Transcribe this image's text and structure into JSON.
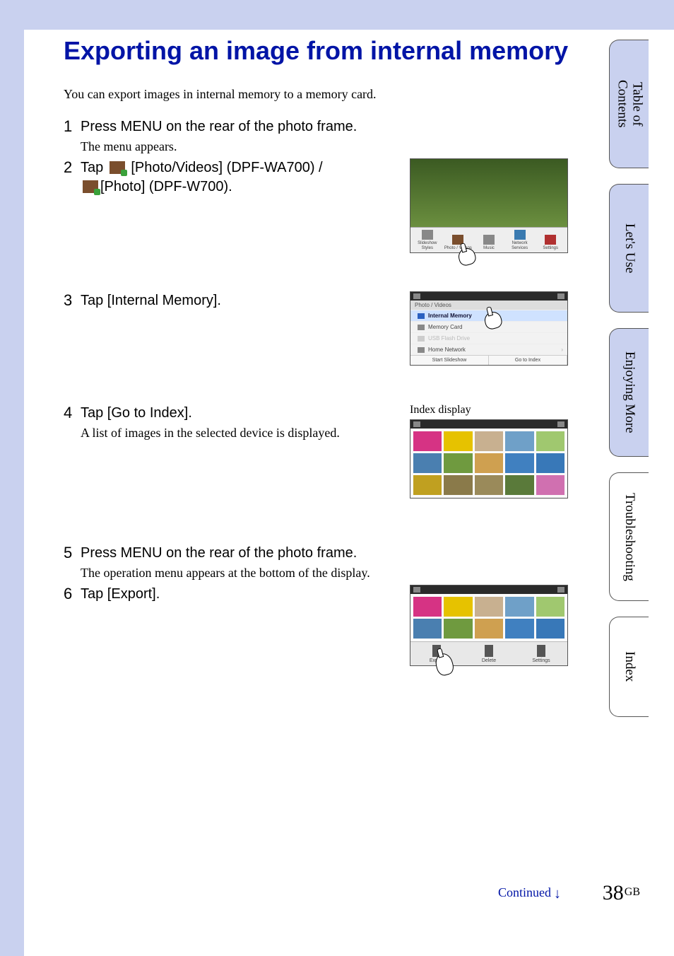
{
  "title": "Exporting an image from internal memory",
  "intro": "You can export images in internal memory to a memory card.",
  "steps": [
    {
      "num": "1",
      "instr": "Press MENU on the rear of the photo frame.",
      "sub": "The menu appears."
    },
    {
      "num": "2",
      "instr_a": "Tap ",
      "instr_b": " [Photo/Videos] (DPF-WA700) / ",
      "instr_c": "[Photo] (DPF-W700)."
    },
    {
      "num": "3",
      "instr": "Tap [Internal Memory]."
    },
    {
      "num": "4",
      "instr": "Tap [Go to Index].",
      "sub": "A list of images in the selected device is displayed."
    },
    {
      "num": "5",
      "instr": "Press MENU on the rear of the photo frame.",
      "sub": "The operation menu appears at the bottom of the display."
    },
    {
      "num": "6",
      "instr": "Tap [Export]."
    }
  ],
  "shot1_menu": [
    "Slideshow Styles",
    "Photo / Videos",
    "Music",
    "Network Services",
    "Settings"
  ],
  "shot2": {
    "title": "Photo / Videos",
    "items": [
      {
        "label": "Internal Memory",
        "sel": true
      },
      {
        "label": "Memory Card"
      },
      {
        "label": "USB Flash Drive",
        "dis": true
      },
      {
        "label": "Home Network"
      }
    ],
    "buttons": [
      "Start Slideshow",
      "Go to Index"
    ]
  },
  "shot3_caption": "Index display",
  "shot4_menu": [
    "Export",
    "Delete",
    "Settings"
  ],
  "tabs": [
    {
      "label": "Table of\nContents",
      "hl": true
    },
    {
      "label": "Let's Use",
      "hl": true
    },
    {
      "label": "Enjoying More",
      "hl": true
    },
    {
      "label": "Troubleshooting",
      "hl": false
    },
    {
      "label": "Index",
      "hl": false
    }
  ],
  "continued": "Continued",
  "page_number": "38",
  "page_suffix": "GB"
}
